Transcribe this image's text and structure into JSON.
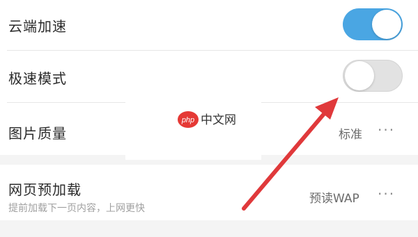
{
  "settings": {
    "cloud_accel": {
      "label": "云端加速",
      "enabled": true
    },
    "speed_mode": {
      "label": "极速模式",
      "enabled": false
    },
    "image_quality": {
      "label": "图片质量",
      "value": "标准",
      "more": "···"
    },
    "page_preload": {
      "label": "网页预加载",
      "description": "提前加载下一页内容，上网更快",
      "value": "预读WAP",
      "more": "···"
    }
  },
  "watermark": {
    "logo_text": "php",
    "site_text": "中文网"
  },
  "colors": {
    "toggle_on": "#4aa6e3",
    "toggle_off": "#e2e2e2",
    "arrow": "#e0393b",
    "watermark_logo": "#e53935"
  }
}
